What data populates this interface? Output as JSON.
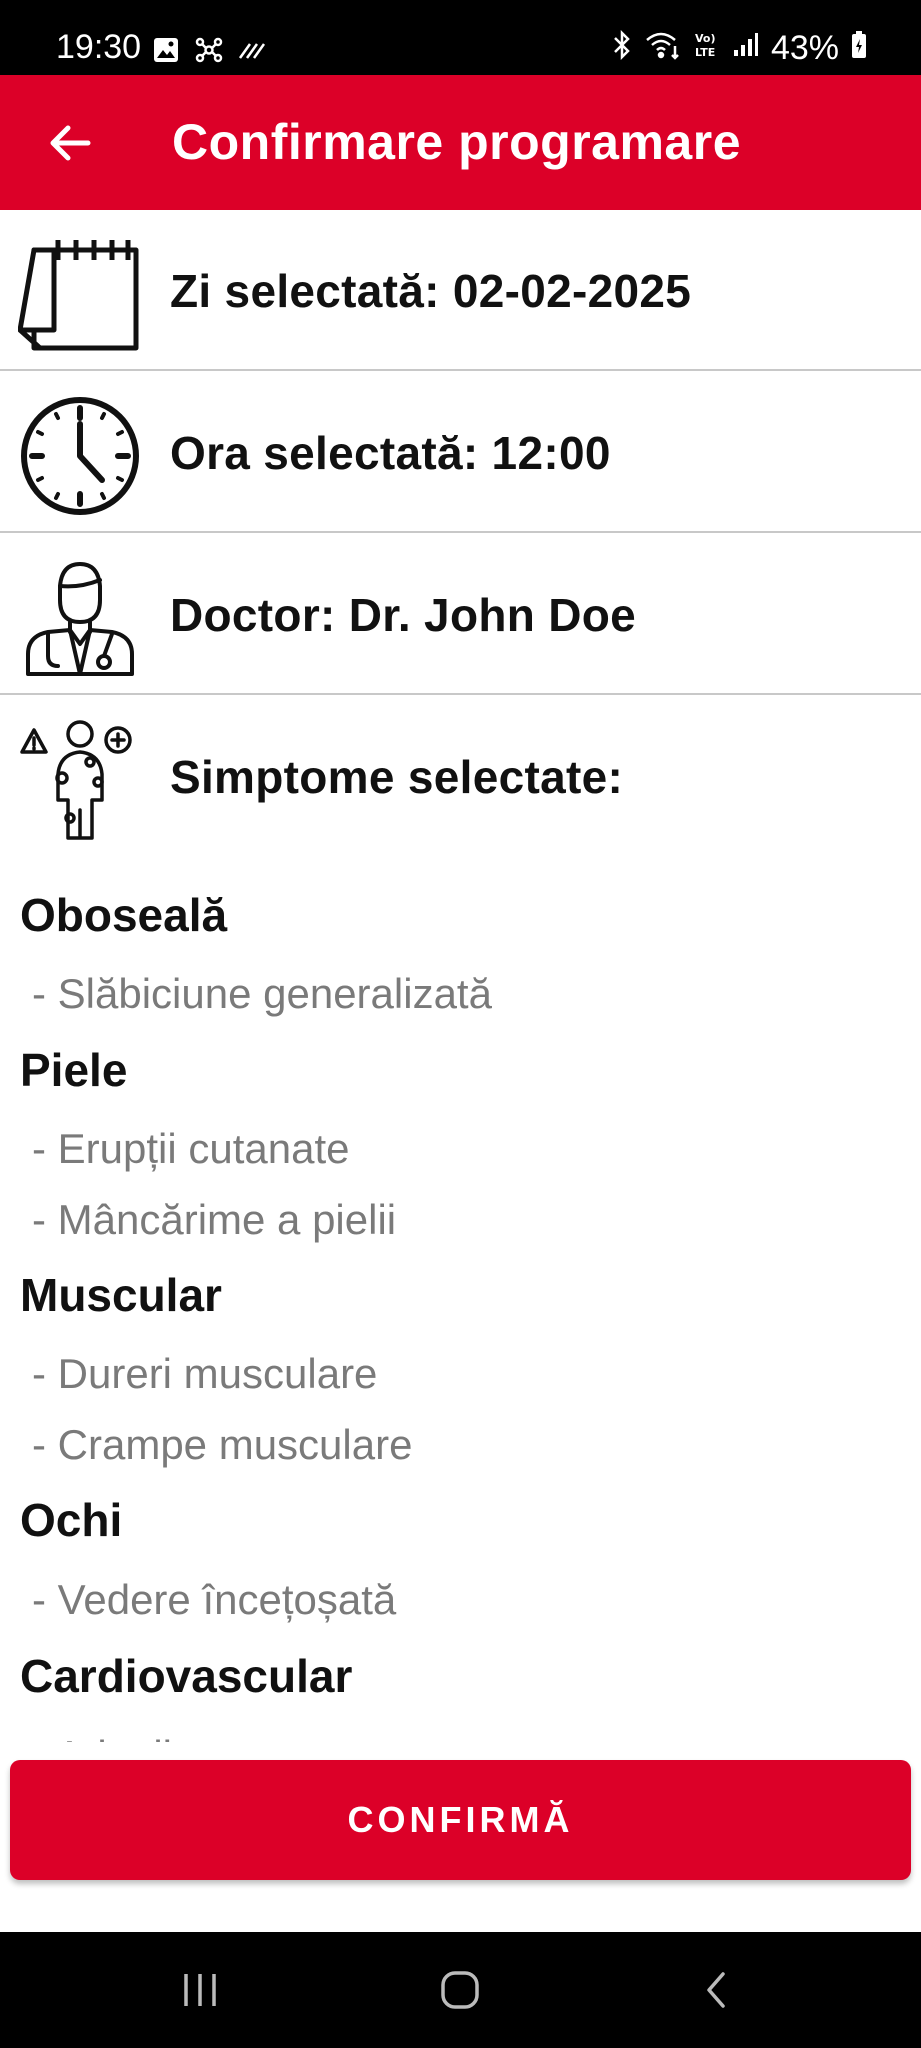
{
  "status_bar": {
    "time": "19:30",
    "battery": "43%",
    "left_icons": [
      "gallery-icon",
      "network-icon",
      "data-saver-icon"
    ],
    "right_icons": [
      "bluetooth-icon",
      "wifi-icon",
      "volte-icon",
      "signal-icon",
      "battery-icon"
    ]
  },
  "header": {
    "title": "Confirmare programare",
    "back_icon": "arrow-left-icon"
  },
  "details": {
    "date": "Zi selectată: 02-02-2025",
    "time": "Ora selectată: 12:00",
    "doctor": "Doctor: Dr. John Doe",
    "symptoms_heading": "Simptome selectate:"
  },
  "symptoms": [
    {
      "category": "Oboseală",
      "items": [
        "- Slăbiciune generalizată"
      ]
    },
    {
      "category": "Piele",
      "items": [
        "- Erupții cutanate",
        "- Mâncărime a pielii"
      ]
    },
    {
      "category": "Muscular",
      "items": [
        "- Dureri musculare",
        "- Crampe musculare"
      ]
    },
    {
      "category": "Ochi",
      "items": [
        "- Vedere încețoșată"
      ]
    },
    {
      "category": "Cardiovascular",
      "items": [
        "- Aritmii"
      ]
    }
  ],
  "confirm_button": {
    "label": "CONFIRMĂ"
  },
  "colors": {
    "accent": "#dc0028",
    "symptom_text": "#7a7a7a",
    "divider": "#c8c8c8"
  },
  "nav_bar": {
    "icons": [
      "recent-apps-icon",
      "home-icon",
      "back-icon"
    ]
  }
}
